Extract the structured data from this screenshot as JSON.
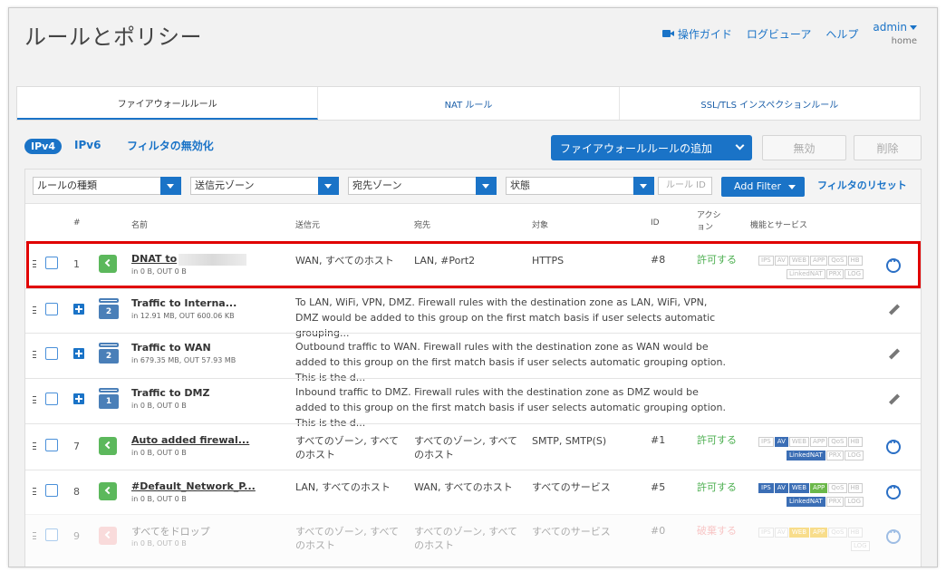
{
  "header": {
    "title": "ルールとポリシー",
    "nav": [
      "操作ガイド",
      "ログビューア",
      "ヘルプ"
    ],
    "user": "admin",
    "user_sub": "home"
  },
  "tabs": [
    "ファイアウォールルール",
    "NAT ルール",
    "SSL/TLS インスペクションルール"
  ],
  "toolbar": {
    "ipv4": "IPv4",
    "ipv6": "IPv6",
    "filter_off": "フィルタの無効化",
    "add_rule": "ファイアウォールルールの追加",
    "disable": "無効",
    "delete": "削除"
  },
  "filters": {
    "rule_type": "ルールの種類",
    "source_zone": "送信元ゾーン",
    "dest_zone": "宛先ゾーン",
    "state": "状態",
    "rule_id_placeholder": "ルール ID",
    "add_filter": "Add Filter",
    "reset": "フィルタのリセット"
  },
  "columns": {
    "num": "#",
    "name": "名前",
    "source": "送信元",
    "dest": "宛先",
    "target": "対象",
    "id": "ID",
    "action_l1": "アクシ",
    "action_l2": "ョン",
    "features": "機能とサービス"
  },
  "rows": [
    {
      "num": "1",
      "name": "DNAT to",
      "sub": "in 0 B, OUT 0 B",
      "source": "WAN, すべてのホスト",
      "dest": "LAN, #Port2",
      "target": "HTTPS",
      "id": "#8",
      "action": "許可する"
    },
    {
      "name": "Traffic to Interna...",
      "sub": "in 12.91 MB, OUT 600.06 KB",
      "group": "2",
      "desc": "To LAN, WiFi, VPN, DMZ. Firewall rules with the destination zone as LAN, WiFi, VPN, DMZ would be added to this group on the first match basis if user selects automatic grouping..."
    },
    {
      "name": "Traffic to WAN",
      "sub": "in 679.35 MB, OUT 57.93 MB",
      "group": "2",
      "desc": "Outbound traffic to WAN. Firewall rules with the destination zone as WAN would be added to this group on the first match basis if user selects automatic grouping option. This is the d..."
    },
    {
      "name": "Traffic to DMZ",
      "sub": "in 0 B, OUT 0 B",
      "group": "1",
      "desc": "Inbound traffic to DMZ. Firewall rules with the destination zone as DMZ would be added to this group on the first match basis if user selects automatic grouping option. This is the d..."
    },
    {
      "num": "7",
      "name": "Auto added firewal...",
      "sub": "in 0 B, OUT 0 B",
      "source": "すべてのゾーン, すべてのホスト",
      "dest": "すべてのゾーン, すべてのホスト",
      "target": "SMTP, SMTP(S)",
      "id": "#1",
      "action": "許可する"
    },
    {
      "num": "8",
      "name": "#Default_Network_P...",
      "sub": "in 0 B, OUT 0 B",
      "source": "LAN, すべてのホスト",
      "dest": "WAN, すべてのホスト",
      "target": "すべてのサービス",
      "id": "#5",
      "action": "許可する"
    },
    {
      "num": "9",
      "name": "すべてをドロップ",
      "sub": "in 0 B, OUT 0 B",
      "source": "すべてのゾーン, すべてのホスト",
      "dest": "すべてのゾーン, すべてのホスト",
      "target": "すべてのサービス",
      "id": "#0",
      "action": "破棄する"
    }
  ],
  "badges": {
    "ips": "IPS",
    "av": "AV",
    "web": "WEB",
    "app": "APP",
    "qos": "QoS",
    "hb": "HB",
    "linkednat": "LinkedNAT",
    "prx": "PRX",
    "log": "LOG"
  }
}
